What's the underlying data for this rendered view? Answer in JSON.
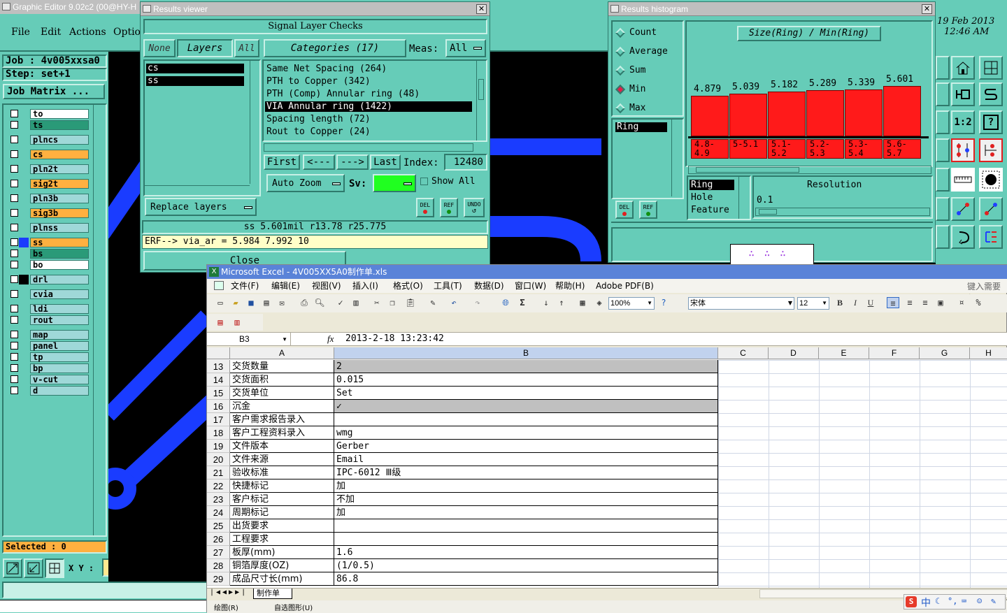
{
  "main_window": {
    "title": "Graphic Editor 9.02c2 (00@HY-H",
    "menu": [
      "File",
      "Edit",
      "Actions",
      "Optio"
    ],
    "job_label": "Job : 4v005xxsa0",
    "step_label": "Step: set+1",
    "job_matrix_label": "Job Matrix ...",
    "layers": [
      {
        "name": "to",
        "color": "#ffffff"
      },
      {
        "name": "ts",
        "color": "#2a9a78"
      },
      {
        "name": "plncs",
        "color": "#9fd8d8"
      },
      {
        "name": "cs",
        "color": "#ffb040"
      },
      {
        "name": "pln2t",
        "color": "#9fd8d8"
      },
      {
        "name": "sig2t",
        "color": "#ffb040"
      },
      {
        "name": "pln3b",
        "color": "#9fd8d8"
      },
      {
        "name": "sig3b",
        "color": "#ffb040"
      },
      {
        "name": "plnss",
        "color": "#9fd8d8"
      },
      {
        "name": "ss",
        "color": "#ffb040"
      },
      {
        "name": "bs",
        "color": "#2a9a78"
      },
      {
        "name": "bo",
        "color": "#ffffff"
      },
      {
        "name": "drl",
        "color": "#9fd8d8"
      },
      {
        "name": "cvia",
        "color": "#9fd8d8"
      },
      {
        "name": "ldi",
        "color": "#9fd8d8"
      },
      {
        "name": "rout",
        "color": "#9fd8d8"
      },
      {
        "name": "map",
        "color": "#9fd8d8"
      },
      {
        "name": "panel",
        "color": "#9fd8d8"
      },
      {
        "name": "tp",
        "color": "#9fd8d8"
      },
      {
        "name": "bp",
        "color": "#9fd8d8"
      },
      {
        "name": "v-cut",
        "color": "#9fd8d8"
      },
      {
        "name": "d",
        "color": "#9fd8d8"
      }
    ],
    "selected_label": "Selected : 0",
    "xy_label": "X Y :",
    "date": "19 Feb 2013",
    "time": "12:46 AM",
    "tool_labels": {
      "ratio": "1:2",
      "help": "?"
    }
  },
  "results_viewer": {
    "title": "Results viewer",
    "heading": "Signal Layer Checks",
    "tabs": {
      "none": "None",
      "layers": "Layers",
      "all": "All"
    },
    "categories_label": "Categories (17)",
    "meas_label": "Meas:",
    "meas_value": "All",
    "layer_items": [
      "cs",
      "ss"
    ],
    "categories": [
      "Same Net Spacing (264)",
      "PTH to Copper (342)",
      "PTH (Comp) Annular ring (48)",
      "VIA Annular ring (1422)",
      "Spacing length (72)",
      "Rout to Copper (24)"
    ],
    "nav": {
      "first": "First",
      "prev": "<---",
      "next": "--->",
      "last": "Last",
      "index_label": "Index:",
      "index_value": "12480"
    },
    "auto_zoom": "Auto Zoom",
    "sv_label": "Sv:",
    "show_all": "Show All",
    "replace_layers": "Replace layers",
    "small_buttons": [
      "DEL",
      "REF",
      "UNDO"
    ],
    "status": "ss 5.601mil  r13.78  r25.775",
    "erf": "ERF--> via_ar = 5.984 7.992 10",
    "close": "Close"
  },
  "histogram": {
    "title": "Results histogram",
    "stats": [
      "Count",
      "Average",
      "Sum",
      "Min",
      "Max"
    ],
    "selected_stat": "Min",
    "chart_title": "Size(Ring) / Min(Ring)",
    "value_labels": [
      "4.879",
      "5.039",
      "5.182",
      "5.289",
      "5.339",
      "5.601"
    ],
    "bin_labels": [
      "4.8-4.9",
      "5-5.1",
      "5.1-5.2",
      "5.2-5.3",
      "5.3-5.4",
      "5.6-5.7"
    ],
    "left_list": [
      "Ring"
    ],
    "features": [
      "Ring",
      "Hole",
      "Feature"
    ],
    "resolution_label": "Resolution",
    "resolution_value": "0.1",
    "buttons": [
      "DEL",
      "REF"
    ]
  },
  "excel": {
    "title": "Microsoft Excel - 4V005XX5A0制作单.xls",
    "menu": [
      "文件(F)",
      "编辑(E)",
      "视图(V)",
      "插入(I)",
      "格式(O)",
      "工具(T)",
      "数据(D)",
      "窗口(W)",
      "帮助(H)",
      "Adobe PDF(B)"
    ],
    "help_box": "键入需要帮",
    "zoom": "100%",
    "font_name": "宋体",
    "font_size": "12",
    "name_box": "B3",
    "formula": "2013-2-18  13:23:42",
    "columns": [
      "A",
      "B",
      "C",
      "D",
      "E",
      "F",
      "G",
      "H"
    ],
    "rows": [
      {
        "num": "13",
        "a": "交货数量",
        "b": "2"
      },
      {
        "num": "14",
        "a": "交货面积",
        "b": "0.015"
      },
      {
        "num": "15",
        "a": "交货单位",
        "b": "Set"
      },
      {
        "num": "16",
        "a": "沉金",
        "b": "✓"
      },
      {
        "num": "17",
        "a": "客户需求报告录入",
        "b": ""
      },
      {
        "num": "18",
        "a": "客户工程资料录入",
        "b": "wmg"
      },
      {
        "num": "19",
        "a": "文件版本",
        "b": "Gerber"
      },
      {
        "num": "20",
        "a": "文件来源",
        "b": "Email"
      },
      {
        "num": "21",
        "a": "验收标准",
        "b": "IPC-6012 Ⅲ级"
      },
      {
        "num": "22",
        "a": "快捷标记",
        "b": "加"
      },
      {
        "num": "23",
        "a": "客户标记",
        "b": "不加"
      },
      {
        "num": "24",
        "a": "周期标记",
        "b": "加"
      },
      {
        "num": "25",
        "a": "出货要求",
        "b": ""
      },
      {
        "num": "26",
        "a": "工程要求",
        "b": ""
      },
      {
        "num": "27",
        "a": "板厚(mm)",
        "b": "1.6"
      },
      {
        "num": "28",
        "a": "铜箔厚度(OZ)",
        "b": "(1/0.5)"
      },
      {
        "num": "29",
        "a": "成品尺寸长(mm)",
        "b": "86.8"
      }
    ],
    "sheet_tab": "制作单",
    "drawing_label": "绘图(R)",
    "autoshape_label": "自选图形(U)",
    "ime": "中"
  }
}
